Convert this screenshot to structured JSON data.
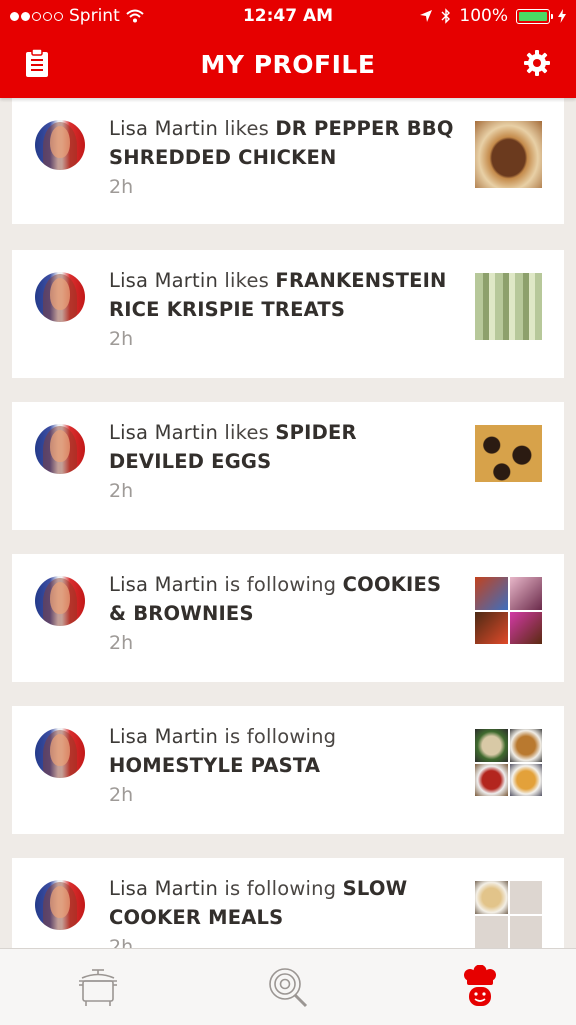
{
  "status_bar": {
    "carrier": "Sprint",
    "time": "12:47 AM",
    "battery": "100%"
  },
  "header": {
    "title": "MY PROFILE"
  },
  "feed": [
    {
      "name": "Lisa Martin",
      "verb": "likes",
      "target": "DR PEPPER BBQ SHREDDED CHICKEN",
      "ago": "2h"
    },
    {
      "name": "Lisa Martin",
      "verb": "likes",
      "target": "FRANKENSTEIN RICE KRISPIE TREATS",
      "ago": "2h"
    },
    {
      "name": "Lisa Martin",
      "verb": "likes",
      "target": "SPIDER DEVILED EGGS",
      "ago": "2h"
    },
    {
      "name": "Lisa Martin",
      "verb": "is following",
      "target": "COOKIES & BROWNIES",
      "ago": "2h"
    },
    {
      "name": "Lisa Martin",
      "verb": "is following",
      "target": "HOMESTYLE PASTA",
      "ago": "2h"
    },
    {
      "name": "Lisa Martin",
      "verb": "is following",
      "target": "SLOW COOKER MEALS",
      "ago": "2h"
    }
  ],
  "colors": {
    "brand_red": "#e60000",
    "background": "#efebe7"
  },
  "icons": {
    "header_left": "clipboard-icon",
    "header_right": "gear-icon",
    "tabs": [
      "cooking-pot-icon",
      "search-pan-icon",
      "chef-profile-icon"
    ]
  }
}
